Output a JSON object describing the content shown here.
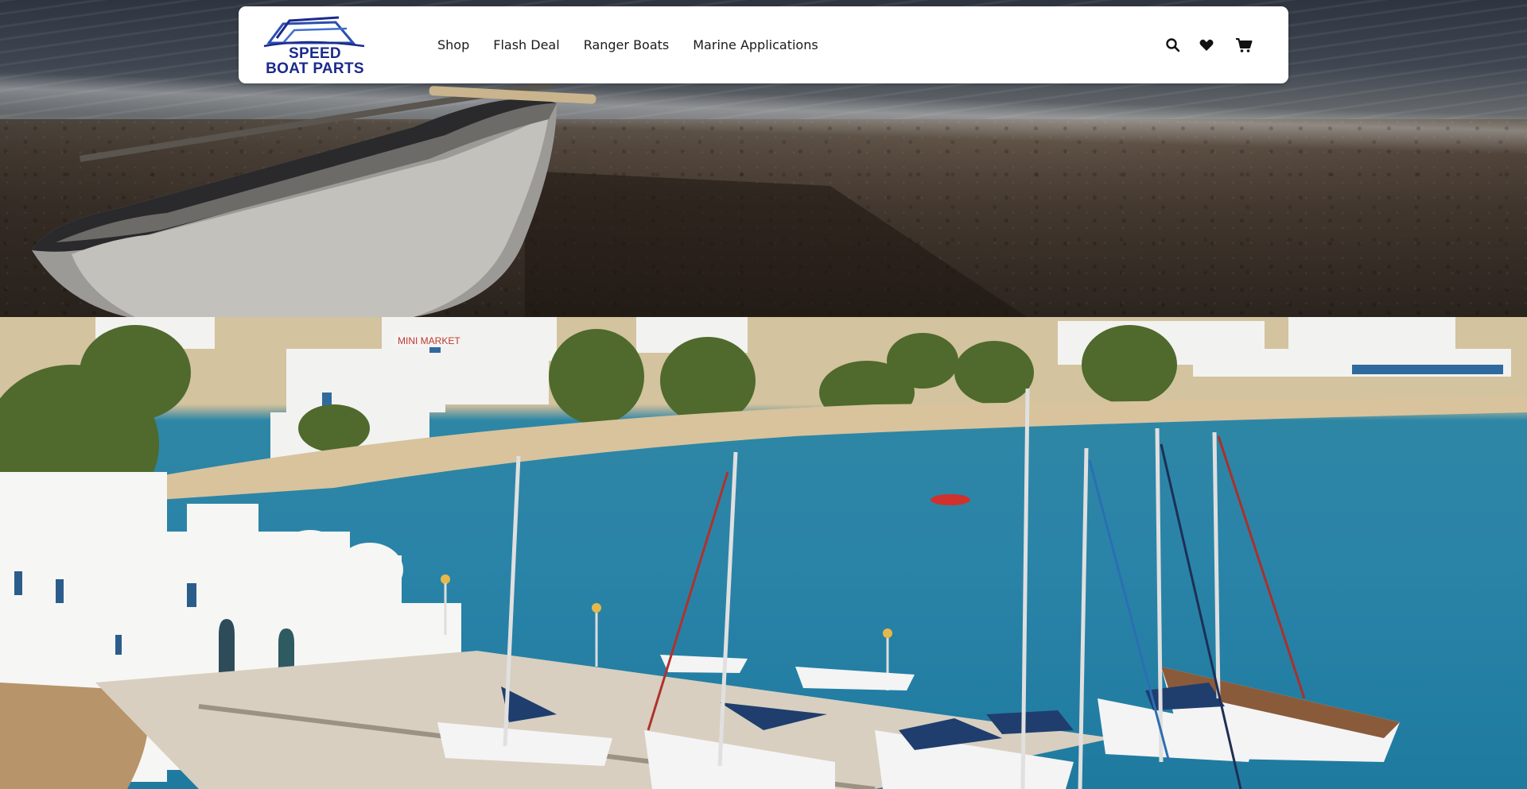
{
  "brand": {
    "logo_line1": "SPEED",
    "logo_line2": "BOAT PARTS",
    "logo_color": "#1b2a8c"
  },
  "nav": {
    "items": [
      {
        "label": "Shop"
      },
      {
        "label": "Flash Deal"
      },
      {
        "label": "Ranger Boats"
      },
      {
        "label": "Marine Applications"
      }
    ]
  },
  "icons": {
    "search": "search-icon",
    "wishlist": "heart-icon",
    "cart": "cart-icon"
  },
  "colors": {
    "navbar_bg": "#ffffff",
    "nav_text": "#1a1a1a"
  }
}
